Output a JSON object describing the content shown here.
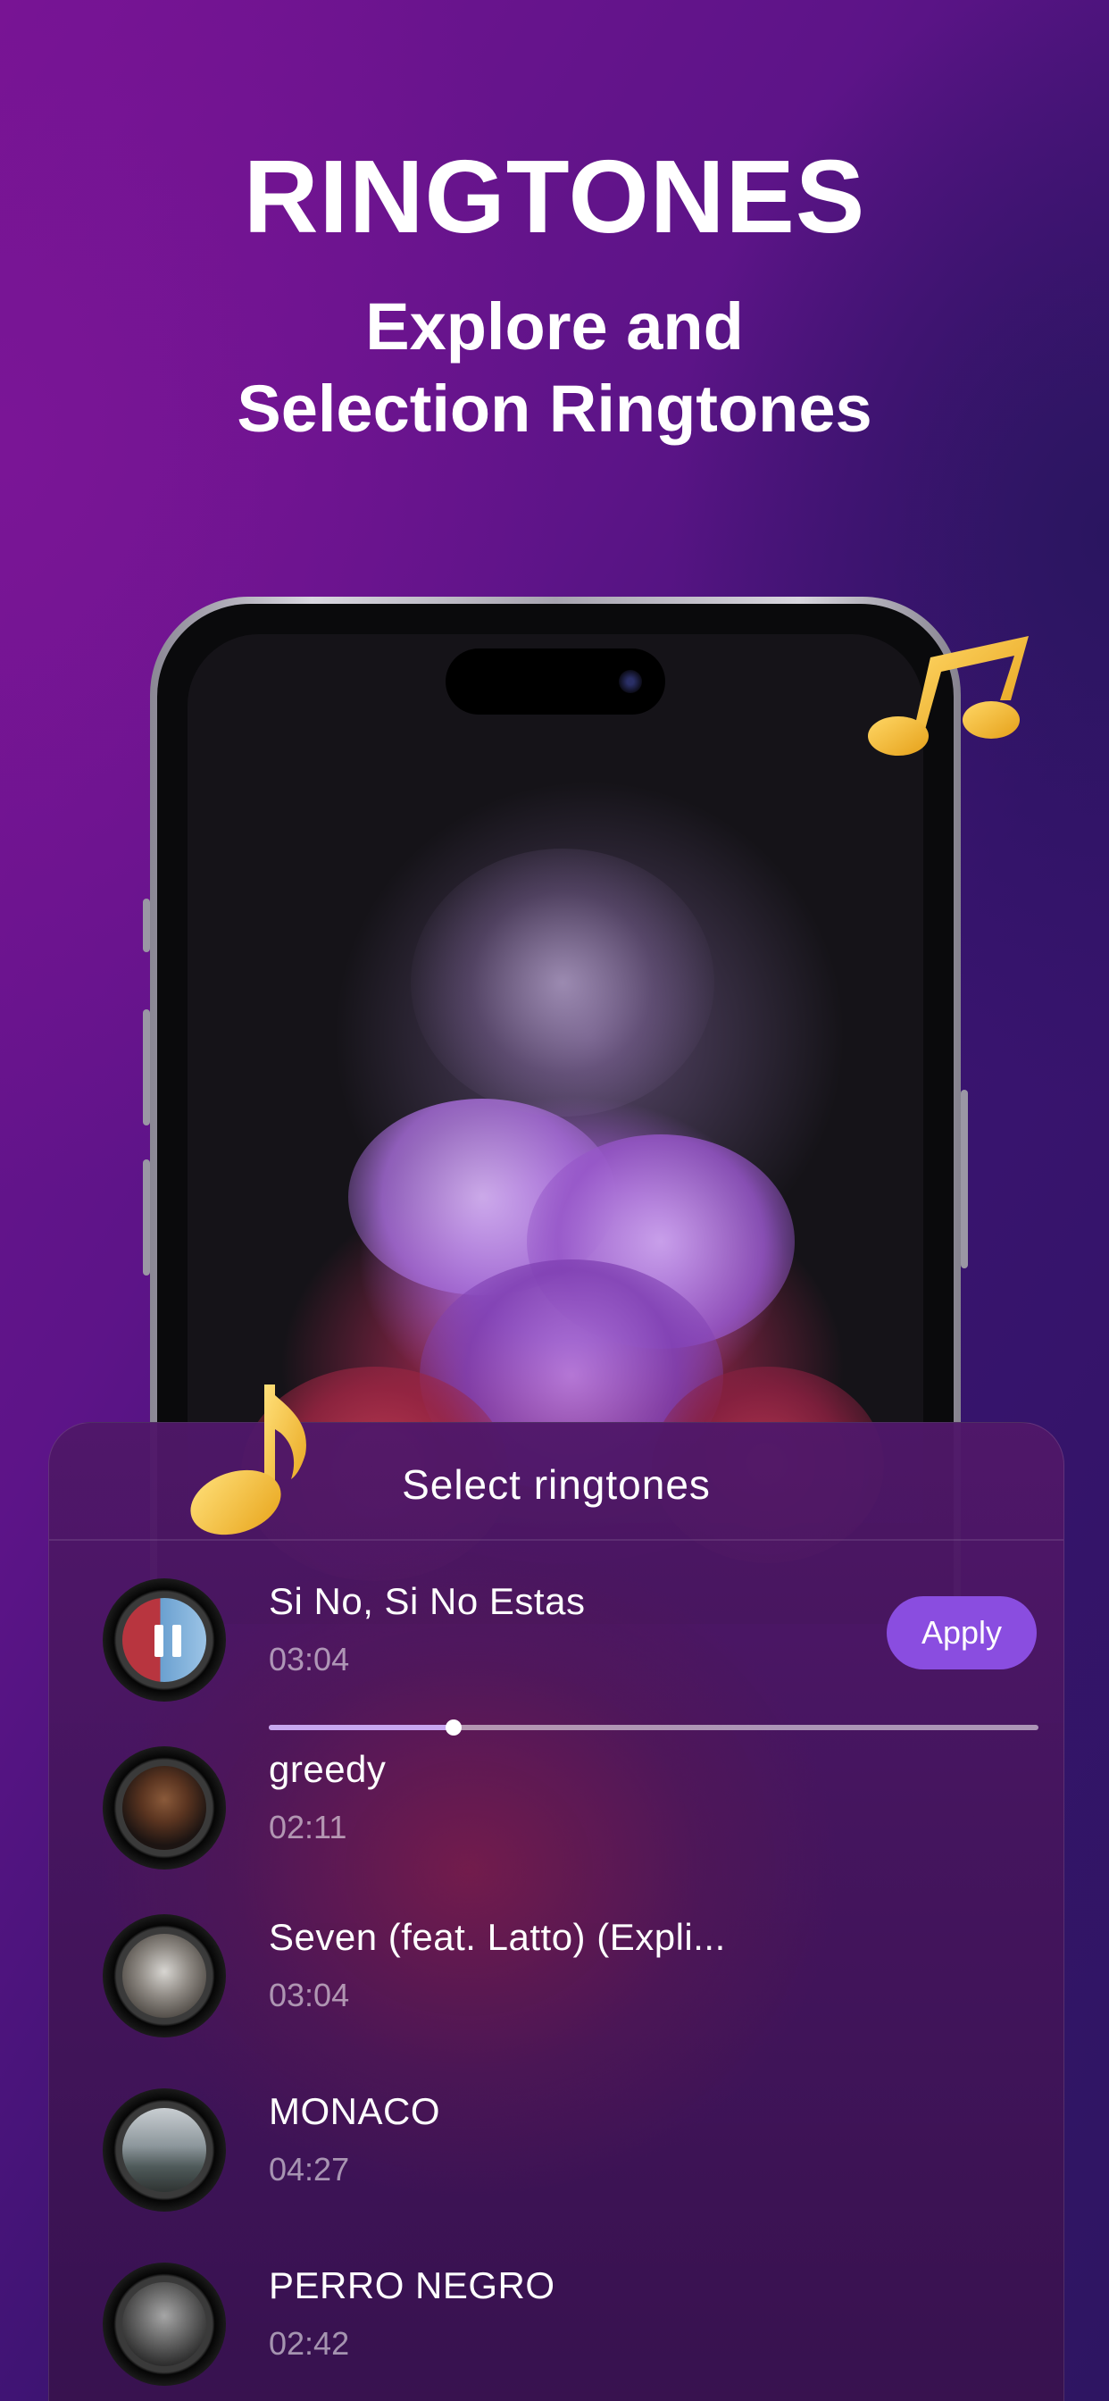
{
  "promo": {
    "headline": "RINGTONES",
    "subline_1": "Explore and",
    "subline_2": "Selection Ringtones"
  },
  "sheet": {
    "title": "Select ringtones",
    "apply_label": "Apply",
    "progress_fraction": 0.24,
    "songs": [
      {
        "title": "Si No,  Si No Estas",
        "time": "03:04",
        "playing": true
      },
      {
        "title": "greedy",
        "time": "02:11",
        "playing": false
      },
      {
        "title": "Seven (feat. Latto) (Expli...",
        "time": "03:04",
        "playing": false
      },
      {
        "title": "MONACO",
        "time": "04:27",
        "playing": false
      },
      {
        "title": "PERRO NEGRO",
        "time": "02:42",
        "playing": false
      }
    ]
  },
  "colors": {
    "accent": "#8a4de0",
    "note": "#f2c23a"
  },
  "icons": [
    "music-note-icon",
    "pause-icon"
  ]
}
